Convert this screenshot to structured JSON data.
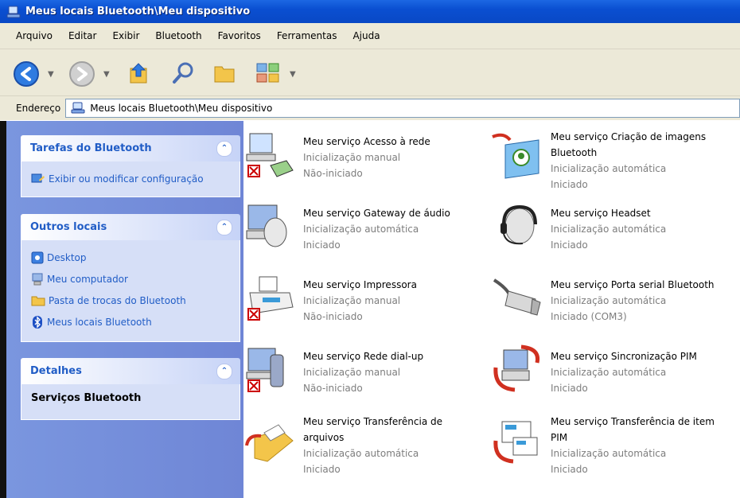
{
  "window": {
    "title": "Meus locais Bluetooth\\Meu dispositivo"
  },
  "menu": [
    "Arquivo",
    "Editar",
    "Exibir",
    "Bluetooth",
    "Favoritos",
    "Ferramentas",
    "Ajuda"
  ],
  "toolbar": {
    "icons": [
      "back-icon",
      "forward-icon",
      "up-folder-icon",
      "search-icon",
      "folders-icon",
      "views-icon"
    ]
  },
  "address": {
    "label": "Endereço",
    "value": "Meus locais Bluetooth\\Meu dispositivo"
  },
  "sidebar": {
    "tasks": {
      "title": "Tarefas do Bluetooth",
      "items": [
        "Exibir ou modificar configuração"
      ]
    },
    "places": {
      "title": "Outros locais",
      "items": [
        "Desktop",
        "Meu computador",
        "Pasta de trocas do Bluetooth",
        "Meus locais Bluetooth"
      ]
    },
    "details": {
      "title": "Detalhes",
      "body": "Serviços Bluetooth"
    }
  },
  "services": [
    {
      "name": "Meu serviço Acesso à rede",
      "startup": "Inicialização manual",
      "status": "Não-iniciado",
      "icon": "network-access-icon"
    },
    {
      "name": "Meu serviço Criação de imagens Bluetooth",
      "startup": "Inicialização automática",
      "status": "Iniciado",
      "icon": "imaging-icon"
    },
    {
      "name": "Meu serviço Gateway de áudio",
      "startup": "Inicialização automática",
      "status": "Iniciado",
      "icon": "audio-gateway-icon"
    },
    {
      "name": "Meu serviço Headset",
      "startup": "Inicialização automática",
      "status": "Iniciado",
      "icon": "headset-icon"
    },
    {
      "name": "Meu serviço Impressora",
      "startup": "Inicialização manual",
      "status": "Não-iniciado",
      "icon": "printer-icon"
    },
    {
      "name": "Meu serviço Porta serial Bluetooth",
      "startup": "Inicialização automática",
      "status": "Iniciado (COM3)",
      "icon": "serial-port-icon"
    },
    {
      "name": "Meu serviço Rede dial-up",
      "startup": "Inicialização manual",
      "status": "Não-iniciado",
      "icon": "dialup-icon"
    },
    {
      "name": "Meu serviço Sincronização PIM",
      "startup": "Inicialização automática",
      "status": "Iniciado",
      "icon": "pim-sync-icon"
    },
    {
      "name": "Meu serviço Transferência de arquivos",
      "startup": "Inicialização automática",
      "status": "Iniciado",
      "icon": "file-transfer-icon"
    },
    {
      "name": "Meu serviço Transferência de item PIM",
      "startup": "Inicialização automática",
      "status": "Iniciado",
      "icon": "pim-item-transfer-icon"
    }
  ]
}
